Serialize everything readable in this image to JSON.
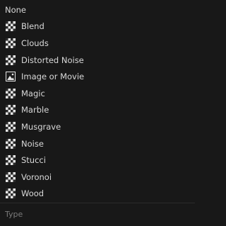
{
  "menu": {
    "items": [
      {
        "label": "None",
        "icon": "none"
      },
      {
        "label": "Blend",
        "icon": "checker-texture-icon"
      },
      {
        "label": "Clouds",
        "icon": "checker-texture-icon"
      },
      {
        "label": "Distorted Noise",
        "icon": "checker-texture-icon"
      },
      {
        "label": "Image or Movie",
        "icon": "image-icon"
      },
      {
        "label": "Magic",
        "icon": "checker-texture-icon"
      },
      {
        "label": "Marble",
        "icon": "checker-texture-icon"
      },
      {
        "label": "Musgrave",
        "icon": "checker-texture-icon"
      },
      {
        "label": "Noise",
        "icon": "checker-texture-icon"
      },
      {
        "label": "Stucci",
        "icon": "checker-texture-icon"
      },
      {
        "label": "Voronoi",
        "icon": "checker-texture-icon"
      },
      {
        "label": "Wood",
        "icon": "checker-texture-icon"
      }
    ],
    "footer_label": "Type"
  },
  "colors": {
    "background": "#181818",
    "text": "#d9d9d9",
    "footer_text": "#7a7a7a"
  }
}
